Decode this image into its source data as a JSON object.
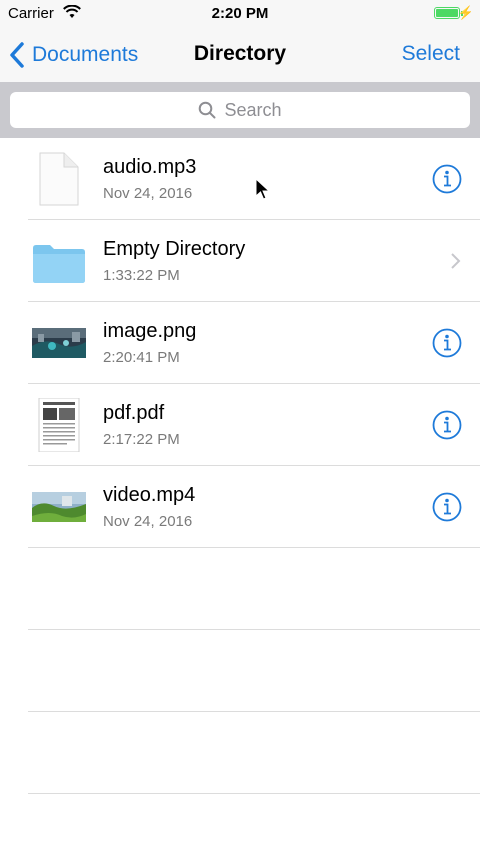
{
  "status_bar": {
    "carrier": "Carrier",
    "time": "2:20 PM",
    "battery_level": 1.0,
    "battery_color": "#4cd964"
  },
  "nav": {
    "back_label": "Documents",
    "title": "Directory",
    "select_label": "Select",
    "accent_color": "#1e7ad9"
  },
  "search": {
    "placeholder": "Search"
  },
  "files": [
    {
      "name": "audio.mp3",
      "meta": "Nov 24, 2016",
      "icon": "document-icon",
      "accessory": "info-icon"
    },
    {
      "name": "Empty Directory",
      "meta": "1:33:22 PM",
      "icon": "folder-icon",
      "accessory": "chevron-right-icon"
    },
    {
      "name": "image.png",
      "meta": "2:20:41 PM",
      "icon": "image-thumbnail",
      "accessory": "info-icon"
    },
    {
      "name": "pdf.pdf",
      "meta": "2:17:22 PM",
      "icon": "pdf-thumbnail",
      "accessory": "info-icon"
    },
    {
      "name": "video.mp4",
      "meta": "Nov 24, 2016",
      "icon": "video-thumbnail",
      "accessory": "info-icon"
    }
  ]
}
